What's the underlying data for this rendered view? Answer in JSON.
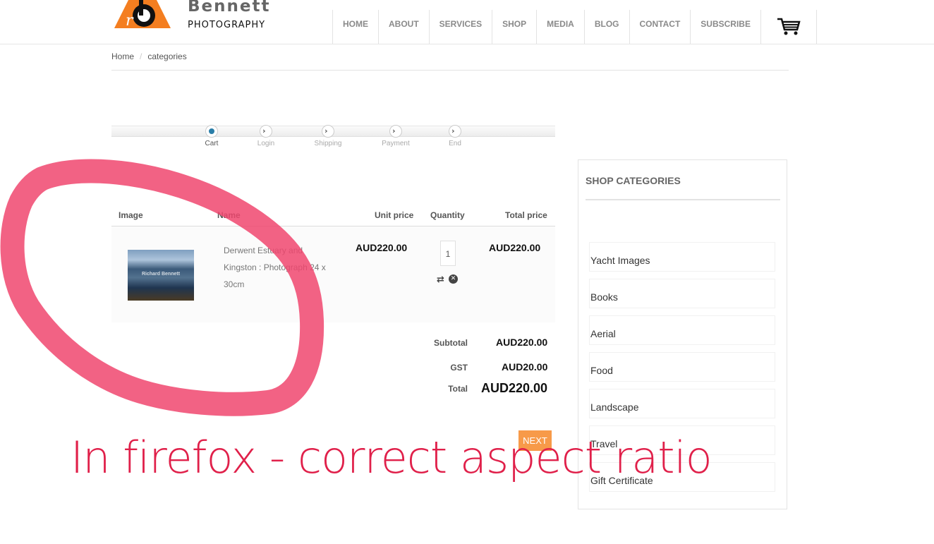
{
  "brand": {
    "name": "Bennett",
    "sub": "PHOTOGRAPHY",
    "logo_letters": "rb",
    "accent": "#f47e20"
  },
  "nav": {
    "items": [
      "HOME",
      "ABOUT",
      "SERVICES",
      "SHOP",
      "MEDIA",
      "BLOG",
      "CONTACT",
      "SUBSCRIBE"
    ],
    "cart_icon": "shopping-cart-icon"
  },
  "breadcrumb": {
    "home": "Home",
    "sep": "/",
    "current": "categories"
  },
  "steps": [
    {
      "label": "Cart",
      "active": true
    },
    {
      "label": "Login",
      "active": false
    },
    {
      "label": "Shipping",
      "active": false
    },
    {
      "label": "Payment",
      "active": false
    },
    {
      "label": "End",
      "active": false
    }
  ],
  "cart": {
    "headers": {
      "image": "Image",
      "name": "Name",
      "unit": "Unit price",
      "qty": "Quantity",
      "total": "Total price"
    },
    "item": {
      "image_watermark": "Richard Bennett",
      "name": "Derwent Estuary and Kingston : Photograph 24 x 30cm",
      "unit_price": "AUD220.00",
      "quantity": "1",
      "total_price": "AUD220.00"
    },
    "summary": {
      "subtotal_label": "Subtotal",
      "subtotal": "AUD220.00",
      "gst_label": "GST",
      "gst": "AUD20.00",
      "total_label": "Total",
      "total": "AUD220.00"
    },
    "next_label": "NEXT"
  },
  "sidebar": {
    "title": "SHOP CATEGORIES",
    "categories": [
      "Yacht Images",
      "Books",
      "Aerial",
      "Food",
      "Landscape",
      "Travel",
      "Gift Certificate"
    ]
  },
  "annotation": {
    "text": "In firefox - correct aspect ratio",
    "color": "#e0204a"
  }
}
